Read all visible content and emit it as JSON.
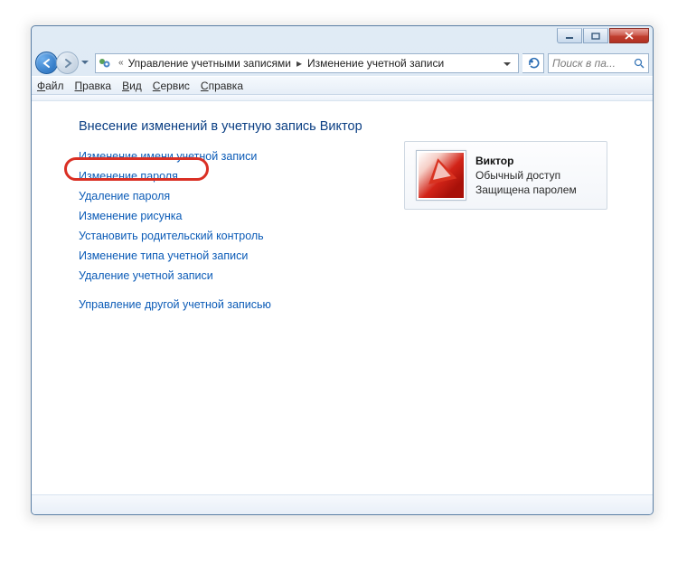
{
  "titlebar": {},
  "breadcrumb": {
    "prefix": "«",
    "part1": "Управление учетными записями",
    "part2": "Изменение учетной записи"
  },
  "search": {
    "placeholder": "Поиск в па..."
  },
  "menu": {
    "file": "Файл",
    "edit": "Правка",
    "view": "Вид",
    "service": "Сервис",
    "help": "Справка"
  },
  "page": {
    "heading": "Внесение изменений в учетную запись Виктор",
    "links": {
      "rename": "Изменение имени учетной записи",
      "change_password": "Изменение пароля",
      "remove_password": "Удаление пароля",
      "change_picture": "Изменение рисунка",
      "parental": "Установить родительский контроль",
      "change_type": "Изменение типа учетной записи",
      "delete_account": "Удаление учетной записи",
      "manage_other": "Управление другой учетной записью"
    }
  },
  "user": {
    "name": "Виктор",
    "role": "Обычный доступ",
    "protection": "Защищена паролем"
  }
}
